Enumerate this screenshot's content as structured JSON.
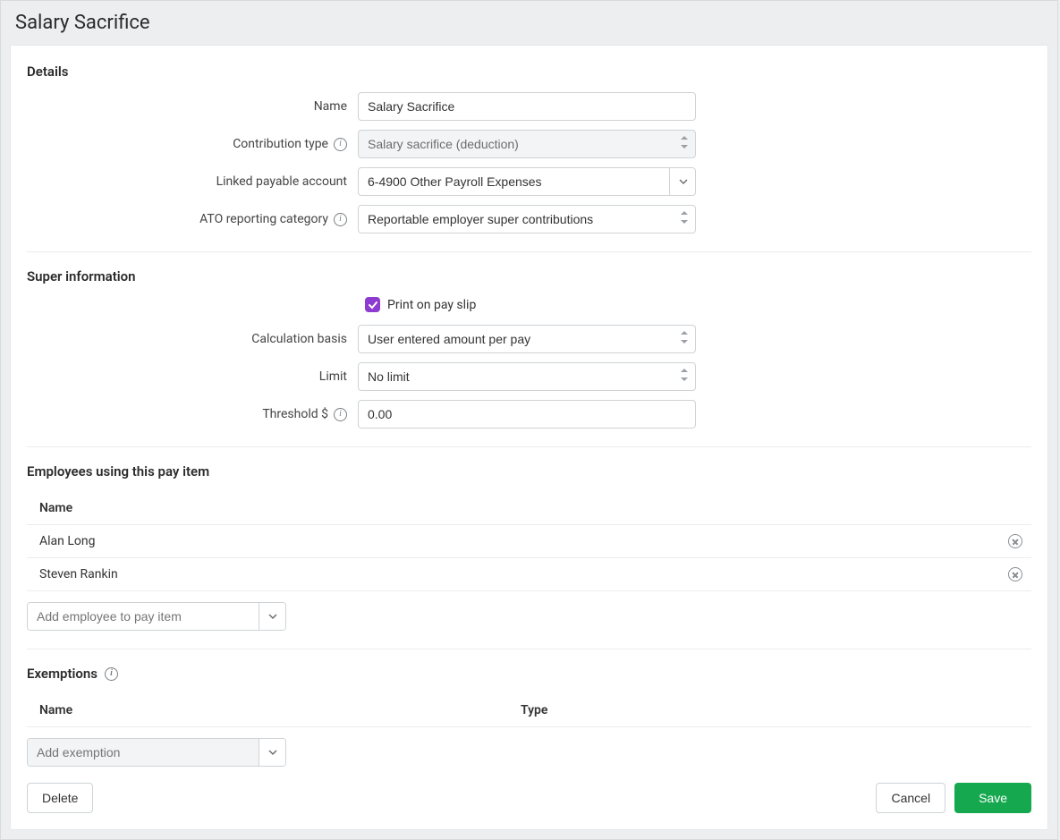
{
  "pageTitle": "Salary Sacrifice",
  "details": {
    "title": "Details",
    "name_label": "Name",
    "name_value": "Salary Sacrifice",
    "contribution_type_label": "Contribution type",
    "contribution_type_value": "Salary sacrifice (deduction)",
    "linked_account_label": "Linked payable account",
    "linked_account_value": "6-4900 Other Payroll Expenses",
    "ato_label": "ATO reporting category",
    "ato_value": "Reportable employer super contributions"
  },
  "super": {
    "title": "Super information",
    "print_label": "Print on pay slip",
    "print_checked": true,
    "calc_basis_label": "Calculation basis",
    "calc_basis_value": "User entered amount per pay",
    "limit_label": "Limit",
    "limit_value": "No limit",
    "threshold_label": "Threshold $",
    "threshold_value": "0.00"
  },
  "employees": {
    "title": "Employees using this pay item",
    "col_name": "Name",
    "rows": [
      {
        "name": "Alan Long"
      },
      {
        "name": "Steven Rankin"
      }
    ],
    "add_placeholder": "Add employee to pay item"
  },
  "exemptions": {
    "title": "Exemptions",
    "col_name": "Name",
    "col_type": "Type",
    "add_placeholder": "Add exemption"
  },
  "footer": {
    "delete": "Delete",
    "cancel": "Cancel",
    "save": "Save"
  }
}
